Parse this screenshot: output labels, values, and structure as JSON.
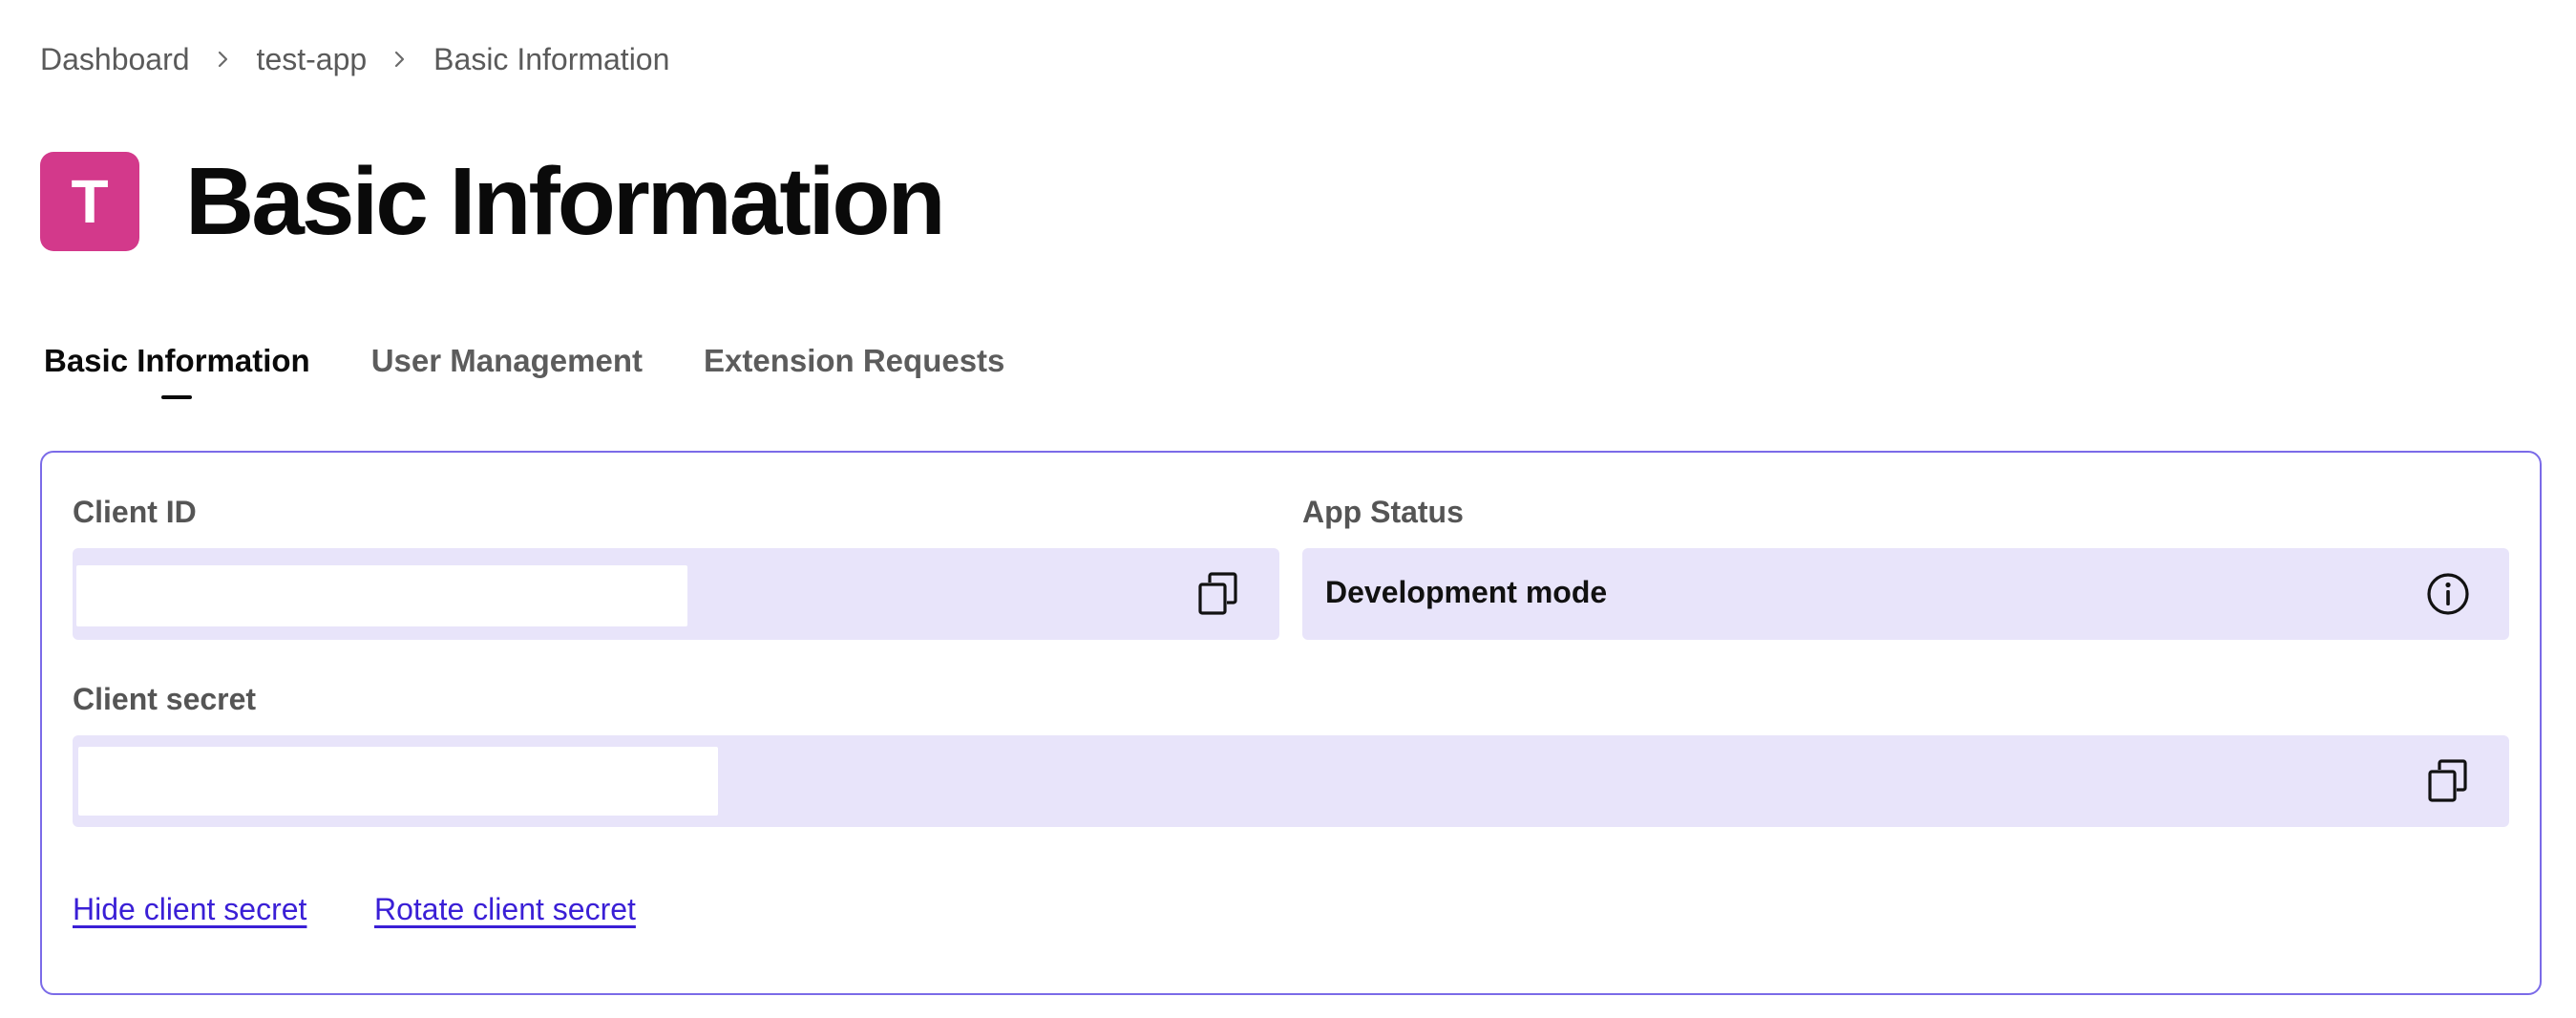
{
  "breadcrumb": {
    "items": [
      "Dashboard",
      "test-app",
      "Basic Information"
    ]
  },
  "app": {
    "avatar_letter": "T",
    "avatar_color": "#d3398b"
  },
  "page": {
    "title": "Basic Information"
  },
  "tabs": [
    {
      "label": "Basic Information",
      "active": true
    },
    {
      "label": "User Management",
      "active": false
    },
    {
      "label": "Extension Requests",
      "active": false
    }
  ],
  "credentials": {
    "client_id_label": "Client ID",
    "client_secret_label": "Client secret",
    "app_status_label": "App Status",
    "app_status_value": "Development mode"
  },
  "actions": {
    "hide_secret": "Hide client secret",
    "rotate_secret": "Rotate client secret"
  },
  "colors": {
    "accent": "#7b6be8",
    "field_background": "#e8e4fa",
    "link": "#3a1fd6"
  },
  "icons": {
    "copy": "copy-icon",
    "info": "info-icon",
    "separator": "chevron-right-icon"
  }
}
